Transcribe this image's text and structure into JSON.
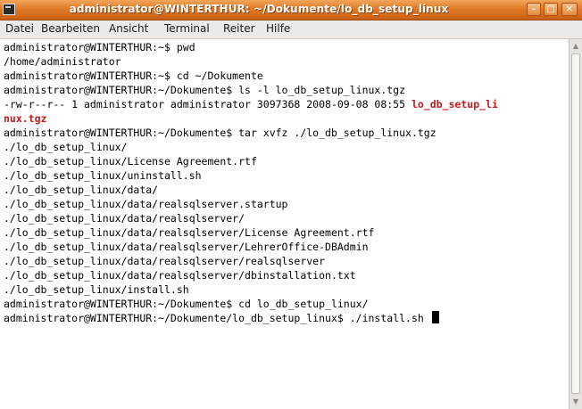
{
  "window": {
    "title": "administrator@WINTERTHUR: ~/Dokumente/lo_db_setup_linux",
    "buttons": {
      "minimize": "–",
      "maximize": "□",
      "close": "✕"
    }
  },
  "menu": {
    "items": [
      {
        "label": "Datei"
      },
      {
        "label": "Bearbeiten"
      },
      {
        "label": "Ansicht"
      },
      {
        "label": "Terminal"
      },
      {
        "label": "Reiter"
      },
      {
        "label": "Hilfe"
      }
    ]
  },
  "terminal": {
    "lines": [
      {
        "text": "administrator@WINTERTHUR:~$ pwd"
      },
      {
        "text": "/home/administrator"
      },
      {
        "text": "administrator@WINTERTHUR:~$ cd ~/Dokumente"
      },
      {
        "text": "administrator@WINTERTHUR:~/Dokumente$ ls -l lo_db_setup_linux.tgz"
      },
      {
        "text": "-rw-r--r-- 1 administrator administrator 3097368 2008-09-08 08:55 ",
        "highlight": "lo_db_setup_li"
      },
      {
        "text": "",
        "highlight": "nux.tgz"
      },
      {
        "text": "administrator@WINTERTHUR:~/Dokumente$ tar xvfz ./lo_db_setup_linux.tgz"
      },
      {
        "text": "./lo_db_setup_linux/"
      },
      {
        "text": "./lo_db_setup_linux/License Agreement.rtf"
      },
      {
        "text": "./lo_db_setup_linux/uninstall.sh"
      },
      {
        "text": "./lo_db_setup_linux/data/"
      },
      {
        "text": "./lo_db_setup_linux/data/realsqlserver.startup"
      },
      {
        "text": "./lo_db_setup_linux/data/realsqlserver/"
      },
      {
        "text": "./lo_db_setup_linux/data/realsqlserver/License Agreement.rtf"
      },
      {
        "text": "./lo_db_setup_linux/data/realsqlserver/LehrerOffice-DBAdmin"
      },
      {
        "text": "./lo_db_setup_linux/data/realsqlserver/realsqlserver"
      },
      {
        "text": "./lo_db_setup_linux/data/realsqlserver/dbinstallation.txt"
      },
      {
        "text": "./lo_db_setup_linux/install.sh"
      },
      {
        "text": "administrator@WINTERTHUR:~/Dokumente$ cd lo_db_setup_linux/"
      },
      {
        "text": "administrator@WINTERTHUR:~/Dokumente/lo_db_setup_linux$ ./install.sh ",
        "cursor": true
      }
    ]
  },
  "colors": {
    "titlebar": "#e07a26",
    "menubar": "#ece9e6",
    "terminal_bg": "#ffffff",
    "terminal_fg": "#000000",
    "highlight": "#c41a1a"
  }
}
